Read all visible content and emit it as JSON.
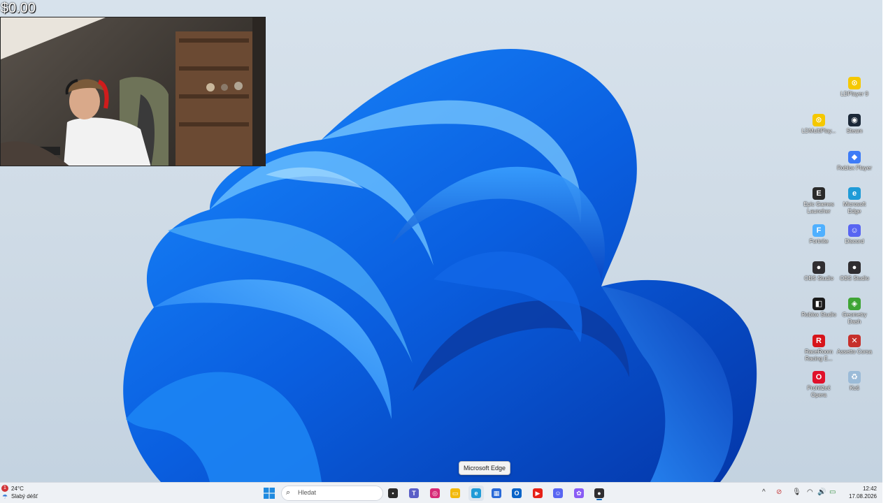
{
  "overlay": {
    "money": "$0.00"
  },
  "desktop_icons": [
    {
      "label": "LDPlayer 9",
      "name": "desktop-icon-ldplayer9",
      "icon": "ldplayer-icon",
      "color": "#f5c800",
      "glyph": "⊙"
    },
    {
      "label": "LDMultiPlay...",
      "name": "desktop-icon-ldmultiplayer",
      "icon": "ldmultiplayer-icon",
      "color": "#f5c800",
      "glyph": "⊙"
    },
    {
      "label": "Steam",
      "name": "desktop-icon-steam",
      "icon": "steam-icon",
      "color": "#1b2838",
      "glyph": "◉"
    },
    {
      "label": "Roblox Player",
      "name": "desktop-icon-roblox-player",
      "icon": "roblox-player-icon",
      "color": "#3d7bf7",
      "glyph": "◆"
    },
    {
      "label": "Epic Games Launcher",
      "name": "desktop-icon-epic-games",
      "icon": "epic-games-icon",
      "color": "#2a2a2a",
      "glyph": "E"
    },
    {
      "label": "Microsoft Edge",
      "name": "desktop-icon-microsoft-edge",
      "icon": "edge-icon",
      "color": "#1f9bd7",
      "glyph": "e"
    },
    {
      "label": "Fortnite",
      "name": "desktop-icon-fortnite",
      "icon": "fortnite-icon",
      "color": "#4fb0ff",
      "glyph": "F"
    },
    {
      "label": "Discord",
      "name": "desktop-icon-discord",
      "icon": "discord-icon",
      "color": "#5865f2",
      "glyph": "☺"
    },
    {
      "label": "OBS Studio",
      "name": "desktop-icon-obs-studio-1",
      "icon": "obs-icon",
      "color": "#302e31",
      "glyph": "●"
    },
    {
      "label": "OBS Studio",
      "name": "desktop-icon-obs-studio-2",
      "icon": "obs-icon",
      "color": "#302e31",
      "glyph": "●"
    },
    {
      "label": "Roblox Studio",
      "name": "desktop-icon-roblox-studio",
      "icon": "roblox-studio-icon",
      "color": "#1a1a1a",
      "glyph": "◧"
    },
    {
      "label": "Geometry Dash",
      "name": "desktop-icon-geometry-dash",
      "icon": "geometry-dash-icon",
      "color": "#3fa535",
      "glyph": "◈"
    },
    {
      "label": "RaceRoom Racing E...",
      "name": "desktop-icon-raceroom",
      "icon": "raceroom-icon",
      "color": "#d7141a",
      "glyph": "R"
    },
    {
      "label": "Assetto Corsa",
      "name": "desktop-icon-assetto-corsa",
      "icon": "assetto-corsa-icon",
      "color": "#c6302b",
      "glyph": "✕"
    },
    {
      "label": "Prohlížeč Opera",
      "name": "desktop-icon-opera",
      "icon": "opera-icon",
      "color": "#e0112b",
      "glyph": "O"
    },
    {
      "label": "Koš",
      "name": "desktop-icon-recycle-bin",
      "icon": "recycle-bin-icon",
      "color": "#9bbbd8",
      "glyph": "♻"
    }
  ],
  "tooltip": {
    "text": "Microsoft Edge"
  },
  "taskbar": {
    "weather": {
      "badge": "1",
      "temp": "24°C",
      "condition": "Slabý déšť"
    },
    "search": {
      "placeholder": "Hledat"
    },
    "apps": [
      {
        "name": "start-button",
        "icon": "windows-start-icon",
        "color": "#1f8ae0",
        "glyph": "⊞"
      },
      {
        "name": "taskbar-task-view",
        "icon": "task-view-icon",
        "color": "#2b2b2b",
        "glyph": "▪"
      },
      {
        "name": "taskbar-teams",
        "icon": "teams-icon",
        "color": "#5b5fc7",
        "glyph": "T"
      },
      {
        "name": "taskbar-instagram",
        "icon": "instagram-icon",
        "color": "#d62976",
        "glyph": "◎"
      },
      {
        "name": "taskbar-file-explorer",
        "icon": "file-explorer-icon",
        "color": "#f2b90c",
        "glyph": "▭"
      },
      {
        "name": "taskbar-edge",
        "icon": "edge-icon",
        "color": "#1f9bd7",
        "glyph": "e"
      },
      {
        "name": "taskbar-store",
        "icon": "store-icon",
        "color": "#2a6ad8",
        "glyph": "▦"
      },
      {
        "name": "taskbar-outlook",
        "icon": "outlook-icon",
        "color": "#0a64c8",
        "glyph": "O"
      },
      {
        "name": "taskbar-youtube",
        "icon": "youtube-icon",
        "color": "#e62117",
        "glyph": "▶"
      },
      {
        "name": "taskbar-discord",
        "icon": "discord-icon",
        "color": "#5865f2",
        "glyph": "☺"
      },
      {
        "name": "taskbar-copilot",
        "icon": "copilot-icon",
        "color": "#8a5cf5",
        "glyph": "✿"
      },
      {
        "name": "taskbar-obs",
        "icon": "obs-icon",
        "color": "#302e31",
        "glyph": "●"
      }
    ],
    "tray": {
      "chevron": "^",
      "time": "12:42",
      "date": "17.08.2026"
    }
  }
}
